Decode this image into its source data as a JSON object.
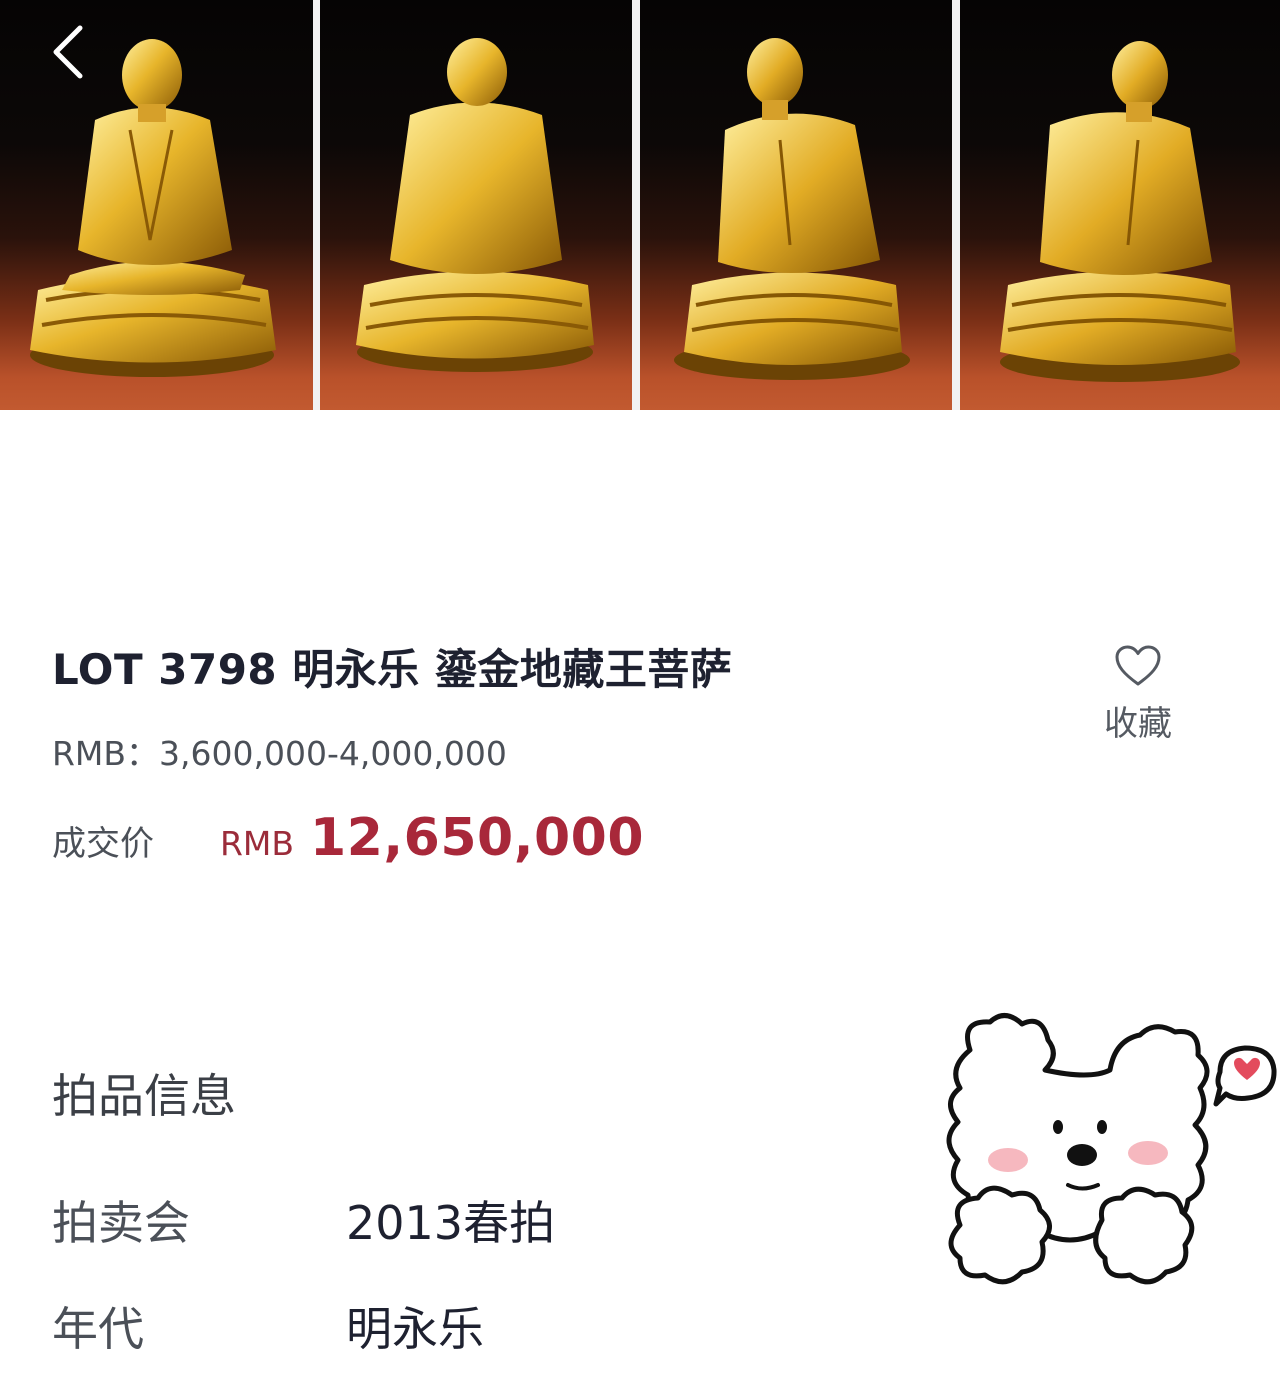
{
  "gallery": {
    "images": [
      {
        "alt": "front-view"
      },
      {
        "alt": "back-view"
      },
      {
        "alt": "left-view"
      },
      {
        "alt": "right-view"
      }
    ]
  },
  "lot": {
    "title": "LOT 3798 明永乐 鎏金地藏王菩萨",
    "estimate_label": "RMB：",
    "estimate_value": "3,600,000-4,000,000",
    "deal_label": "成交价",
    "deal_currency": "RMB",
    "deal_amount": "12,650,000",
    "favorite_label": "收藏"
  },
  "auction_info": {
    "section_title": "拍品信息",
    "rows": [
      {
        "key": "拍卖会",
        "value": "2013春拍"
      },
      {
        "key": "年代",
        "value": "明永乐"
      }
    ]
  },
  "colors": {
    "price_red": "#a8283a",
    "title_dark": "#1e2130",
    "gold": "#e0b02a"
  }
}
